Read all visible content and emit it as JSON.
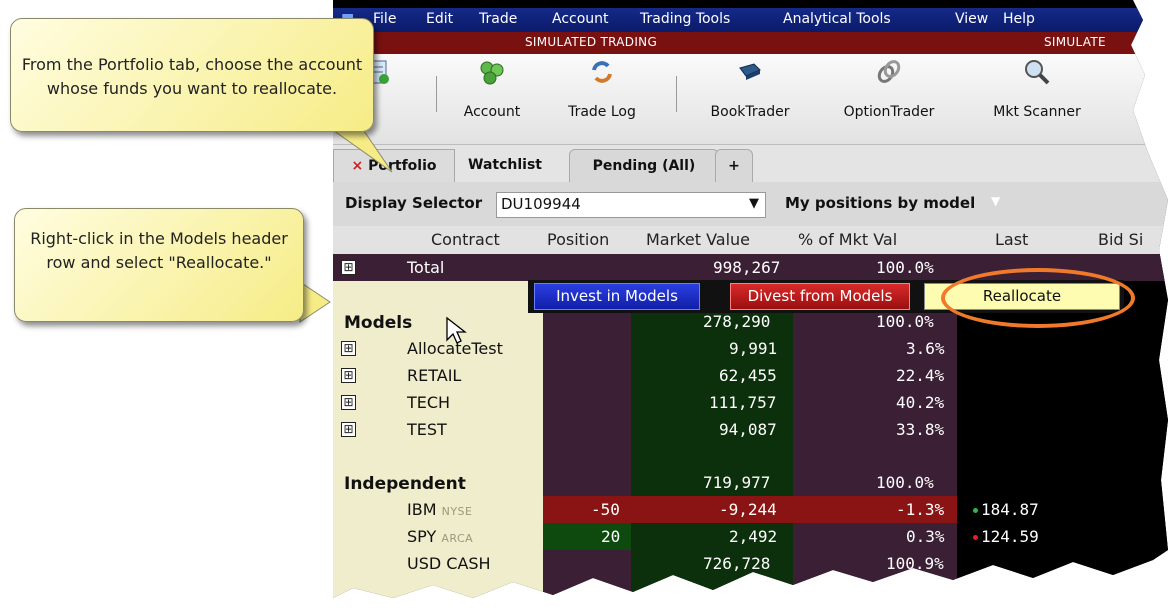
{
  "menubar": {
    "items": [
      "File",
      "Edit",
      "Trade",
      "Account",
      "Trading Tools",
      "Analytical Tools",
      "View",
      "Help"
    ]
  },
  "sim_bar": {
    "left": "SIMULATED TRADING",
    "right": "SIMULATE"
  },
  "toolbar": {
    "buttons": [
      {
        "label": "",
        "icon": "order-icon"
      },
      {
        "label": "Account",
        "icon": "account-icon"
      },
      {
        "label": "Trade Log",
        "icon": "trade-log-icon"
      },
      {
        "label": "BookTrader",
        "icon": "booktrader-icon"
      },
      {
        "label": "OptionTrader",
        "icon": "optiontrader-icon"
      },
      {
        "label": "Mkt Scanner",
        "icon": "scanner-icon"
      }
    ]
  },
  "tabs": [
    {
      "label": "Portfolio",
      "close": "×"
    },
    {
      "label": "Watchlist"
    },
    {
      "label": "Pending (All)"
    },
    {
      "label": "+"
    }
  ],
  "selector": {
    "label": "Display Selector",
    "value": "DU109944",
    "arrow": "▼",
    "model_view": "My positions by model",
    "model_arrow": "▼"
  },
  "columns": [
    "Contract",
    "Position",
    "Market Value",
    "% of Mkt Val",
    "Last",
    "Bid Si"
  ],
  "total_row": {
    "label": "Total",
    "market_value": "998,267",
    "pct": "100.0%",
    "expander": "⊞"
  },
  "context_menu": {
    "invest": "Invest in Models",
    "divest": "Divest from Models",
    "reallocate": "Reallocate"
  },
  "models_section": {
    "label": "Models",
    "market_value": "278,290",
    "pct": "100.0%",
    "rows": [
      {
        "name": "AllocateTest",
        "market_value": "9,991",
        "pct": "3.6%"
      },
      {
        "name": "RETAIL",
        "market_value": "62,455",
        "pct": "22.4%"
      },
      {
        "name": "TECH",
        "market_value": "111,757",
        "pct": "40.2%"
      },
      {
        "name": "TEST",
        "market_value": "94,087",
        "pct": "33.8%"
      }
    ]
  },
  "independent_section": {
    "label": "Independent",
    "market_value": "719,977",
    "pct": "100.0%",
    "rows": [
      {
        "symbol": "IBM",
        "exchange": "NYSE",
        "position": "-50",
        "market_value": "-9,244",
        "pct": "-1.3%",
        "last": "184.87",
        "last_dot_color": "#2db84a"
      },
      {
        "symbol": "SPY",
        "exchange": "ARCA",
        "position": "20",
        "market_value": "2,492",
        "pct": "0.3%",
        "last": "124.59",
        "last_dot_color": "#e52222"
      },
      {
        "symbol": "USD CASH",
        "exchange": "",
        "position": "",
        "market_value": "726,728",
        "pct": "100.9%",
        "last": ""
      }
    ]
  },
  "callouts": {
    "top": "From the Portfolio tab, choose the account whose funds you want to reallocate.",
    "bottom": "Right-click in the Models header row and select \"Reallocate.\""
  },
  "colors": {
    "menubar": "#0b1a6a",
    "sim_bar": "#7a1111",
    "highlight_ring": "#f07a2a",
    "negative": "#a01818",
    "positive": "#0e5e0e"
  }
}
